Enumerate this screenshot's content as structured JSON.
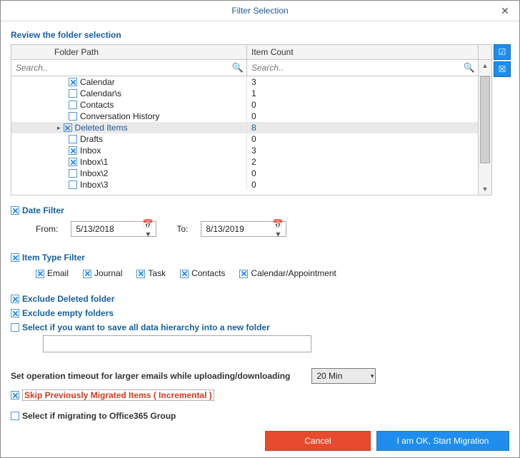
{
  "window": {
    "title": "Filter Selection"
  },
  "header": {
    "review": "Review the folder selection"
  },
  "grid": {
    "headers": {
      "path": "Folder Path",
      "count": "Item Count"
    },
    "search_placeholder": "Search..",
    "rows": [
      {
        "name": "Calendar",
        "count": "3",
        "checked": true,
        "selected": false
      },
      {
        "name": "Calendar\\s",
        "count": "1",
        "checked": false,
        "selected": false
      },
      {
        "name": "Contacts",
        "count": "0",
        "checked": false,
        "selected": false
      },
      {
        "name": "Conversation History",
        "count": "0",
        "checked": false,
        "selected": false
      },
      {
        "name": "Deleted Items",
        "count": "8",
        "checked": true,
        "selected": true
      },
      {
        "name": "Drafts",
        "count": "0",
        "checked": false,
        "selected": false
      },
      {
        "name": "Inbox",
        "count": "3",
        "checked": true,
        "selected": false
      },
      {
        "name": "Inbox\\1",
        "count": "2",
        "checked": true,
        "selected": false
      },
      {
        "name": "Inbox\\2",
        "count": "0",
        "checked": false,
        "selected": false
      },
      {
        "name": "Inbox\\3",
        "count": "0",
        "checked": false,
        "selected": false
      }
    ]
  },
  "date_filter": {
    "label": "Date Filter",
    "checked": true,
    "from_label": "From:",
    "to_label": "To:",
    "from_value": "5/13/2018",
    "to_value": "8/13/2019"
  },
  "type_filter": {
    "label": "Item Type Filter",
    "checked": true,
    "email": {
      "label": "Email",
      "checked": true
    },
    "journal": {
      "label": "Journal",
      "checked": true
    },
    "task": {
      "label": "Task",
      "checked": true
    },
    "contacts": {
      "label": "Contacts",
      "checked": true
    },
    "cal": {
      "label": "Calendar/Appointment",
      "checked": true
    }
  },
  "options": {
    "excl_deleted": {
      "label": "Exclude Deleted folder",
      "checked": true
    },
    "excl_empty": {
      "label": "Exclude empty folders",
      "checked": true
    },
    "save_hier": {
      "label": "Select if you want to save all data hierarchy into a new folder",
      "checked": false
    }
  },
  "timeout": {
    "label": "Set operation timeout for larger emails while uploading/downloading",
    "value": "20 Min"
  },
  "skip_prev": {
    "label": "Skip Previously Migrated Items ( Incremental )",
    "checked": true
  },
  "o365": {
    "label": "Select if migrating to Office365 Group",
    "checked": false
  },
  "footer": {
    "cancel": "Cancel",
    "ok": "I am OK, Start Migration"
  }
}
